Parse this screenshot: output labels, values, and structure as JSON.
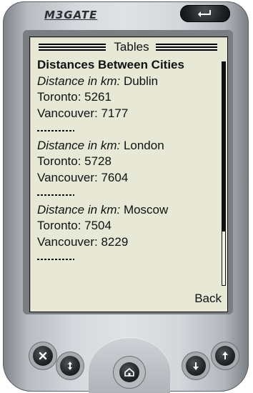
{
  "device": {
    "brand": "M3GATE"
  },
  "screen": {
    "title": "Tables",
    "heading": "Distances Between Cities",
    "label": "Distance in km:",
    "entries": [
      {
        "city": "Dublin",
        "toronto": "Toronto: 5261",
        "vancouver": "Vancouver: 7177"
      },
      {
        "city": "London",
        "toronto": "Toronto: 5728",
        "vancouver": "Vancouver: 7604"
      },
      {
        "city": "Moscow",
        "toronto": "Toronto: 7504",
        "vancouver": "Vancouver: 8229"
      }
    ],
    "separator": "---------",
    "back": "Back",
    "scroll_fraction": 0.76
  },
  "colors": {
    "screen_bg": "#e8e8d6",
    "text": "#111111",
    "device_body": "#d6dade"
  },
  "icons": {
    "back_arrow": "return-arrow-icon",
    "close": "close-icon",
    "scroll": "scroll-icon",
    "home": "home-icon",
    "down": "down-icon",
    "up": "up-icon"
  }
}
